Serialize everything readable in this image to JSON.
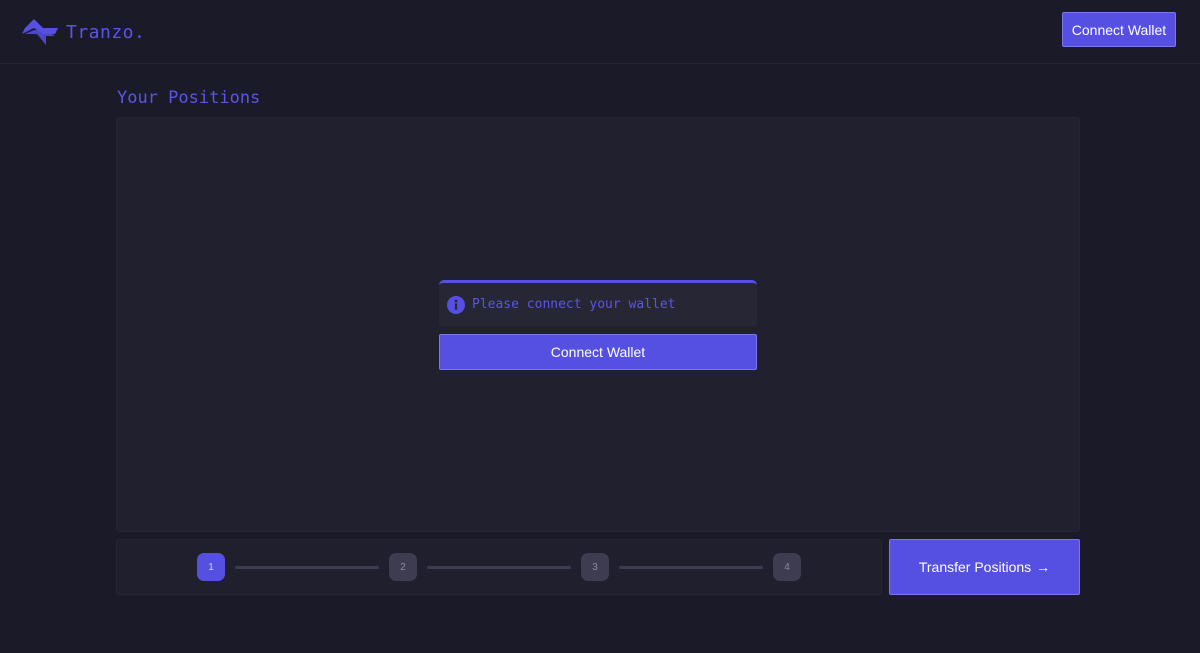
{
  "header": {
    "logo_text": "Tranzo.",
    "connect_label": "Connect Wallet"
  },
  "positions": {
    "title": "Your Positions",
    "alert_text": "Please connect your wallet",
    "connect_label": "Connect Wallet"
  },
  "stepper": {
    "steps": [
      "1",
      "2",
      "3",
      "4"
    ],
    "active_step": 1
  },
  "transfer": {
    "label": "Transfer Positions",
    "arrow": "→"
  },
  "icons": {
    "logo": "lightning-bolt-icon",
    "info": "info-circle-icon",
    "arrow": "arrow-right-icon"
  },
  "colors": {
    "background": "#1b1a29",
    "panel": "#20202f",
    "accent": "#5650e2",
    "step_inactive": "#3d3c50"
  }
}
